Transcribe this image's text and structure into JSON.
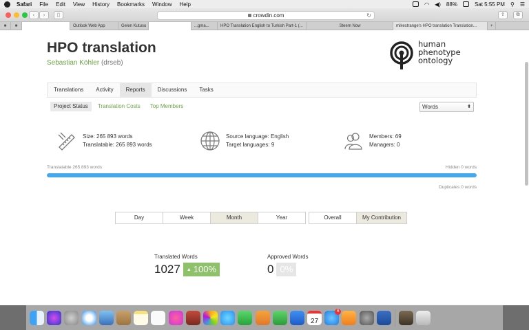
{
  "menubar": {
    "app": "Safari",
    "items": [
      "File",
      "Edit",
      "View",
      "History",
      "Bookmarks",
      "Window",
      "Help"
    ],
    "battery": "88%",
    "clock": "Sat 5:55 PM"
  },
  "browser": {
    "url": "crowdin.com",
    "tabs": [
      {
        "label": "",
        "type": "blank"
      },
      {
        "label": "Outlook Web App",
        "type": "normal"
      },
      {
        "label": "Gelen Kutusu",
        "type": "normal"
      },
      {
        "label": "",
        "type": "blank"
      },
      {
        "label": "...gma...",
        "type": "normal"
      },
      {
        "label": "HPO Translation English to Turkish Part-1 (...",
        "type": "normal"
      },
      {
        "label": "Steem Now",
        "type": "normal"
      },
      {
        "label": "mikestrange's HPO translation Translation...",
        "type": "active"
      }
    ]
  },
  "project": {
    "title": "HPO translation",
    "owner_name": "Sebastian Köhler",
    "owner_user": "(drseb)",
    "logo_lines": [
      "human",
      "phenotype",
      "ontology"
    ]
  },
  "nav": {
    "tabs": [
      {
        "label": "Translations",
        "active": false
      },
      {
        "label": "Activity",
        "active": false
      },
      {
        "label": "Reports",
        "active": true
      },
      {
        "label": "Discussions",
        "active": false
      },
      {
        "label": "Tasks",
        "active": false
      }
    ]
  },
  "subnav": {
    "tabs": [
      {
        "label": "Project Status",
        "active": true
      },
      {
        "label": "Translation Costs",
        "active": false
      },
      {
        "label": "Top Members",
        "active": false
      }
    ],
    "unit_select": "Words"
  },
  "stats": {
    "size": "Size: 265 893 words",
    "translatable": "Translatable: 265 893 words",
    "source_language": "Source language: English",
    "target_languages": "Target languages: 9",
    "members": "Members: 69",
    "managers": "Managers: 0"
  },
  "progress": {
    "left_label": "Translatable 265 893 words",
    "right_label": "Hidden 0 words",
    "duplicates_label": "Duplicates 0 words",
    "fill_fraction": 1.0
  },
  "periods": {
    "items": [
      {
        "label": "Day",
        "active": false
      },
      {
        "label": "Week",
        "active": false
      },
      {
        "label": "Month",
        "active": true
      },
      {
        "label": "Year",
        "active": false
      }
    ]
  },
  "views": {
    "items": [
      {
        "label": "Overall",
        "active": false
      },
      {
        "label": "My Contribution",
        "active": true
      }
    ]
  },
  "metrics": {
    "translated": {
      "label": "Translated Words",
      "value": "1027",
      "pct": "100%"
    },
    "approved": {
      "label": "Approved Words",
      "value": "0",
      "pct": "0%"
    }
  },
  "colors": {
    "accent_green": "#6aa542",
    "progress_blue": "#44a8ef",
    "pct_green": "#8dc16a"
  },
  "dock": {
    "icons": [
      "finder-icon",
      "siri-icon",
      "launchpad-icon",
      "safari-icon",
      "preview-icon",
      "contacts-icon",
      "notes-icon",
      "reminders-icon",
      "itunes-icon",
      "photo-booth-icon",
      "photos-icon",
      "messages-icon",
      "facetime-icon",
      "pages-icon",
      "numbers-icon",
      "keynote-icon",
      "calendar-icon",
      "app-store-icon",
      "ibooks-icon",
      "system-preferences-icon",
      "word-icon",
      "image-icon",
      "trash-icon"
    ],
    "calendar_day": "27",
    "app_store_badge": "6"
  }
}
